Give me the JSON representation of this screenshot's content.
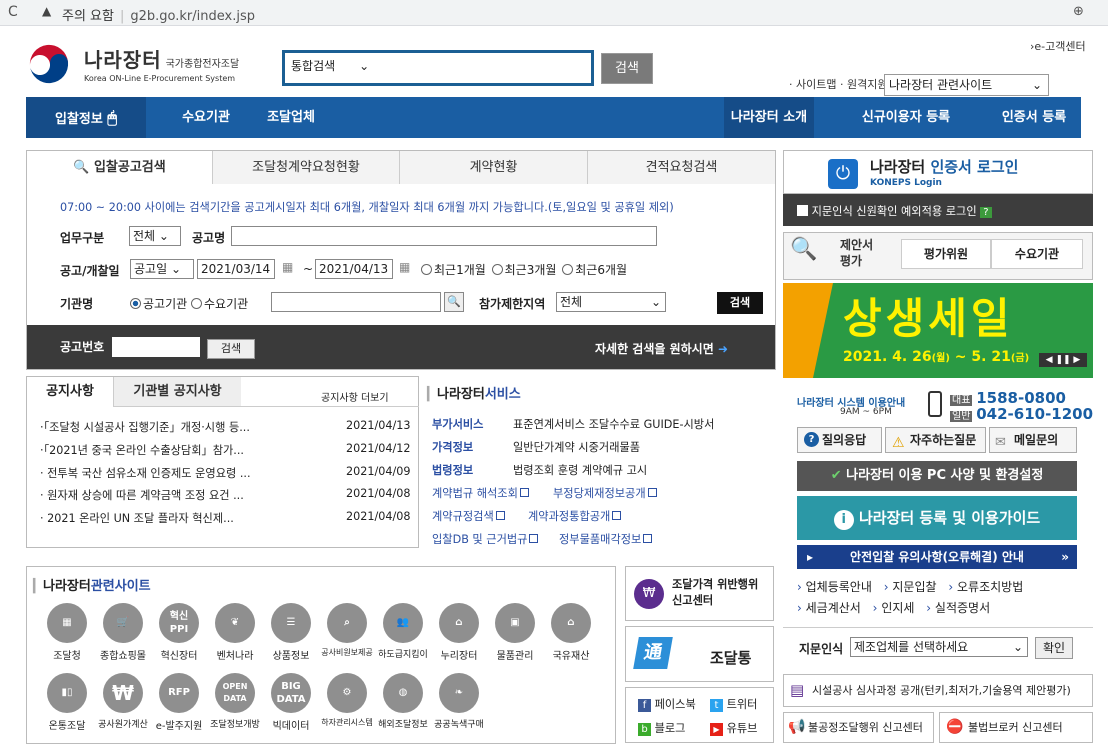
{
  "browser": {
    "security": "주의 요함",
    "url": "g2b.go.kr/index.jsp"
  },
  "header": {
    "logo_ko": "나라장터",
    "logo_sub": "국가종합전자조달",
    "logo_en": "Korea ON-Line E-Procurement System",
    "search_option": "통합검색",
    "search_button": "검색",
    "ecenter": "›e-고객센터",
    "sitemap": "· 사이트맵 · 원격지원",
    "related_select": "나라장터 관련사이트"
  },
  "nav": {
    "items": [
      "입찰정보",
      "수요기관",
      "조달업체"
    ],
    "right_items": [
      "나라장터 소개",
      "신규이용자 등록",
      "인증서 등록"
    ]
  },
  "search": {
    "tabs": [
      "입찰공고검색",
      "조달청계약요청현황",
      "계약현황",
      "견적요청검색"
    ],
    "notice": "07:00 ~ 20:00 사이에는 검색기간을 공고게시일자 최대 6개월, 개찰일자 최대 6개월 까지 가능합니다.(토,일요일 및 공휴일 제외)",
    "task_label": "업무구분",
    "task_value": "전체",
    "notice_name_label": "공고명",
    "date_label": "공고/개찰일",
    "date_type": "공고일",
    "date_from": "2021/03/14",
    "date_tilde": "~",
    "date_to": "2021/04/13",
    "period_options": [
      "최근1개월",
      "최근3개월",
      "최근6개월"
    ],
    "agency_label": "기관명",
    "agency_options": [
      "공고기관",
      "수요기관"
    ],
    "region_label": "참가제한지역",
    "region_value": "전체",
    "search_button": "검색",
    "bid_no_label": "공고번호",
    "bid_no_button": "검색",
    "detail_text": "자세한 검색을 원하시면"
  },
  "notices": {
    "tabs": [
      "공지사항",
      "기관별 공지사항"
    ],
    "more": "공지사항 더보기",
    "rows": [
      {
        "title": "·「조달청 시설공사 집행기준」개정·시행 등...",
        "date": "2021/04/13"
      },
      {
        "title": "·「2021년 중국 온라인 수출상담회」참가...",
        "date": "2021/04/12"
      },
      {
        "title": "· 전투복 국산 섬유소재 인증제도 운영요령 ...",
        "date": "2021/04/09"
      },
      {
        "title": "· 원자재 상승에 따른 계약금액 조정 요건 ...",
        "date": "2021/04/08"
      },
      {
        "title": "· 2021 온라인 UN 조달 플라자 혁신제...",
        "date": "2021/04/08"
      }
    ]
  },
  "services": {
    "title_a": "나라장터",
    "title_b": "서비스",
    "rows": [
      {
        "head": "부가서비스",
        "items": "표준연계서비스  조달수수료  GUIDE-시방서"
      },
      {
        "head": "가격정보",
        "items": "일반단가계약  시중거래물품"
      },
      {
        "head": "법령정보",
        "items": "법령조회  훈령  계약예규  고시"
      }
    ],
    "links": [
      "계약법규 해석조회",
      "부정당제재정보공개",
      "계약규정검색",
      "계약과정통합공개",
      "입찰DB 및 근거법규",
      "정부물품매각정보"
    ]
  },
  "related": {
    "title_a": "나라장터",
    "title_b": "관련사이트",
    "row1": [
      "조달청",
      "종합쇼핑몰",
      "혁신장터",
      "벤처나라",
      "상품정보",
      "공사비원보제공",
      "하도급지킴이",
      "누리장터",
      "물품관리",
      "국유재산"
    ],
    "row2": [
      "온통조달",
      "공사원가계산",
      "e-발주지원",
      "조달정보개방",
      "빅데이터",
      "하자관리시스템",
      "해외조달정보",
      "공공녹색구매"
    ],
    "icon_text": {
      "innovation": "혁신\nPPI",
      "rfp": "RFP",
      "open": "OPEN\nDATA",
      "big": "BIG\nDATA"
    }
  },
  "mid_banners": {
    "report": "조달가격 위반행위\n신고센터",
    "app_logo": "通",
    "app_name": "조달통",
    "facebook": "페이스북",
    "twitter": "트위터",
    "blog": "블로그",
    "youtube": "유튜브"
  },
  "right": {
    "login_title_a": "나라장터 ",
    "login_title_b": "인증서 로그인",
    "login_sub": "KONEPS Login",
    "fingerprint_exception": "지문인식 신원확인 예외적용 로그인",
    "proposal": "제안서\n평가",
    "eval_btn": "평가위원",
    "demand_btn": "수요기관",
    "banner_title": "상생세일",
    "banner_date": "2021. 4. 26",
    "banner_day1": "(월)",
    "banner_date_to": "~ 5. 21",
    "banner_day2": "(금)",
    "guide_title": "나라장터 시스템 이용안내",
    "guide_hours": "9AM ~ 6PM",
    "tel_label1": "대표",
    "tel1": "1588-0800",
    "tel_label2": "일반",
    "tel2": "042-610-1200",
    "qa": [
      "질의응답",
      "자주하는질문",
      "메일문의"
    ],
    "pc_env": "나라장터 이용 PC 사양 및 환경설정",
    "guide": "나라장터 등록 및 이용가이드",
    "safe_bid": "안전입찰 유의사항(오류해결) 안내",
    "bullets1": [
      "업체등록안내",
      "지문입찰",
      "오류조치방법"
    ],
    "bullets2": [
      "세금계산서",
      "인지세",
      "실적증명서"
    ],
    "fp_label": "지문인식",
    "fp_select": "제조업체를 선택하세요",
    "fp_ok": "확인",
    "review": "시설공사 심사과정 공개(턴키,최저가,기술용역 제안평가)",
    "report1": "불공정조달행위 신고센터",
    "report2": "불법브로커 신고센터"
  }
}
